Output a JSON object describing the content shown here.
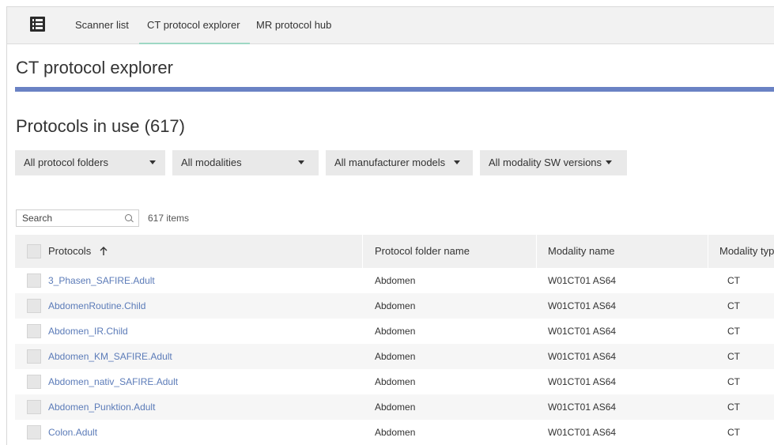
{
  "nav": {
    "tabs": [
      {
        "label": "Scanner list"
      },
      {
        "label": "CT protocol explorer",
        "active": true
      },
      {
        "label": "MR protocol hub"
      }
    ]
  },
  "page": {
    "title": "CT protocol explorer",
    "section_title": "Protocols in use (617)"
  },
  "filters": [
    {
      "label": "All protocol folders"
    },
    {
      "label": "All modalities"
    },
    {
      "label": "All manufacturer models"
    },
    {
      "label": "All modality SW versions"
    }
  ],
  "search": {
    "placeholder": "Search",
    "count_text": "617 items"
  },
  "table": {
    "columns": [
      "Protocols",
      "Protocol folder name",
      "Modality name",
      "Modality type"
    ],
    "sort_column": "Protocols",
    "rows": [
      {
        "protocol": "3_Phasen_SAFIRE.Adult",
        "folder": "Abdomen",
        "modality": "W01CT01 AS64",
        "type": "CT"
      },
      {
        "protocol": "AbdomenRoutine.Child",
        "folder": "Abdomen",
        "modality": "W01CT01 AS64",
        "type": "CT"
      },
      {
        "protocol": "Abdomen_IR.Child",
        "folder": "Abdomen",
        "modality": "W01CT01 AS64",
        "type": "CT"
      },
      {
        "protocol": "Abdomen_KM_SAFIRE.Adult",
        "folder": "Abdomen",
        "modality": "W01CT01 AS64",
        "type": "CT"
      },
      {
        "protocol": "Abdomen_nativ_SAFIRE.Adult",
        "folder": "Abdomen",
        "modality": "W01CT01 AS64",
        "type": "CT"
      },
      {
        "protocol": "Abdomen_Punktion.Adult",
        "folder": "Abdomen",
        "modality": "W01CT01 AS64",
        "type": "CT"
      },
      {
        "protocol": "Colon.Adult",
        "folder": "Abdomen",
        "modality": "W01CT01 AS64",
        "type": "CT"
      }
    ]
  },
  "colors": {
    "accent_bar": "#6a82c4",
    "active_tab_underline": "#9ed8c4",
    "link": "#5b7bb8"
  }
}
